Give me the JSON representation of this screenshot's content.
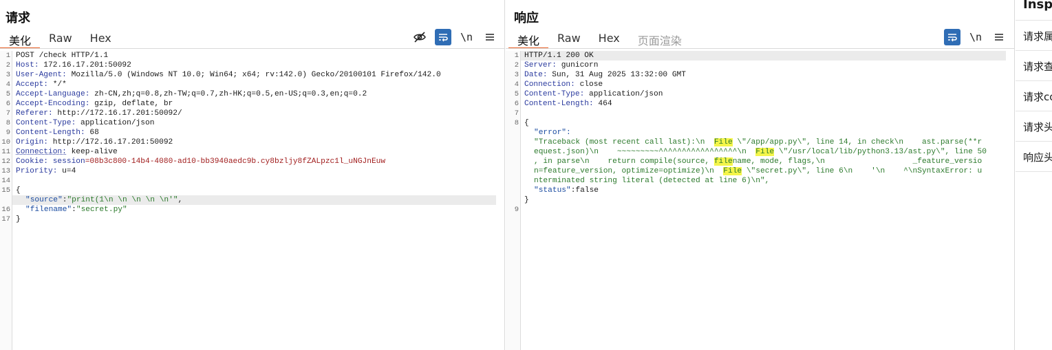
{
  "request": {
    "title": "请求",
    "tabs": [
      "美化",
      "Raw",
      "Hex"
    ],
    "toolbar": {
      "newline": "\\n"
    },
    "lines": [
      {
        "n": "1",
        "name": "POST /check HTTP/1.1",
        "value": ""
      },
      {
        "n": "2",
        "name": "Host:",
        "value": " 172.16.17.201:50092"
      },
      {
        "n": "3",
        "name": "User-Agent:",
        "value": " Mozilla/5.0 (Windows NT 10.0; Win64; x64; rv:142.0) Gecko/20100101 Firefox/142.0"
      },
      {
        "n": "4",
        "name": "Accept:",
        "value": " */*"
      },
      {
        "n": "5",
        "name": "Accept-Language:",
        "value": " zh-CN,zh;q=0.8,zh-TW;q=0.7,zh-HK;q=0.5,en-US;q=0.3,en;q=0.2"
      },
      {
        "n": "6",
        "name": "Accept-Encoding:",
        "value": " gzip, deflate, br"
      },
      {
        "n": "7",
        "name": "Referer:",
        "value": " http://172.16.17.201:50092/"
      },
      {
        "n": "8",
        "name": "Content-Type:",
        "value": " application/json"
      },
      {
        "n": "9",
        "name": "Content-Length:",
        "value": " 68"
      },
      {
        "n": "10",
        "name": "Origin:",
        "value": " http://172.16.17.201:50092"
      },
      {
        "n": "11",
        "name": "Connection:",
        "value": " keep-alive"
      },
      {
        "n": "12",
        "name": "Cookie:",
        "cookie_name": " session",
        "value": "=08b3c800-14b4-4080-ad10-bb3940aedc9b.cy8bzljy8fZALpzc1l_uNGJnEuw"
      },
      {
        "n": "13",
        "name": "Priority:",
        "value": " u=4"
      },
      {
        "n": "14",
        "name": "",
        "value": ""
      }
    ],
    "body": {
      "open": "{",
      "source_key": "\"source\"",
      "source_val": "\"print(1\\n \\n \\n \\n \\n'\"",
      "filename_key": "\"filename\"",
      "filename_val": "\"secret.py\"",
      "close": "}"
    },
    "body_line_numbers": [
      "15",
      "16",
      "17"
    ]
  },
  "response": {
    "title": "响应",
    "tabs": [
      "美化",
      "Raw",
      "Hex",
      "页面渲染"
    ],
    "toolbar": {
      "newline": "\\n"
    },
    "status_line": "HTTP/1.1 200 OK",
    "headers": [
      {
        "n": "2",
        "name": "Server:",
        "value": " gunicorn"
      },
      {
        "n": "3",
        "name": "Date:",
        "value": " Sun, 31 Aug 2025 13:32:00 GMT"
      },
      {
        "n": "4",
        "name": "Connection:",
        "value": " close"
      },
      {
        "n": "5",
        "name": "Content-Type:",
        "value": " application/json"
      },
      {
        "n": "6",
        "name": "Content-Length:",
        "value": " 464"
      }
    ],
    "line_numbers": [
      "1",
      "7",
      "8",
      "9"
    ],
    "body": {
      "open": "{",
      "error_key": "\"error\":",
      "err1a": "\"Traceback (most recent call last):\\n  ",
      "err1b": "File",
      "err1c": " \\\"/app/app.py\\\", line 14, in check\\n    ast.parse(**r",
      "err2a": "equest.json)\\n    ~~~~~~~~~^^^^^^^^^^^^^^^^^\\n  ",
      "err2b": "File",
      "err2c": " \\\"/usr/local/lib/python3.13/ast.py\\\", line 50",
      "err3a": ", in parse\\n    return compile(source, ",
      "err3b": "file",
      "err3c": "name, mode, flags,\\n                   _feature_versio",
      "err4a": "n=feature_version, optimize=optimize)\\n  ",
      "err4b": "File",
      "err4c": " \\\"secret.py\\\", line 6\\n    '\\n    ^\\nSyntaxError: u",
      "err5": "nterminated string literal (detected at line 6)\\n\",",
      "status_key": "\"status\"",
      "status_val": ":false",
      "close": "}"
    }
  },
  "inspector": {
    "title": "Inspector",
    "items": [
      "请求属性",
      "请求查询参数",
      "请求cookie",
      "请求头",
      "响应头"
    ]
  }
}
